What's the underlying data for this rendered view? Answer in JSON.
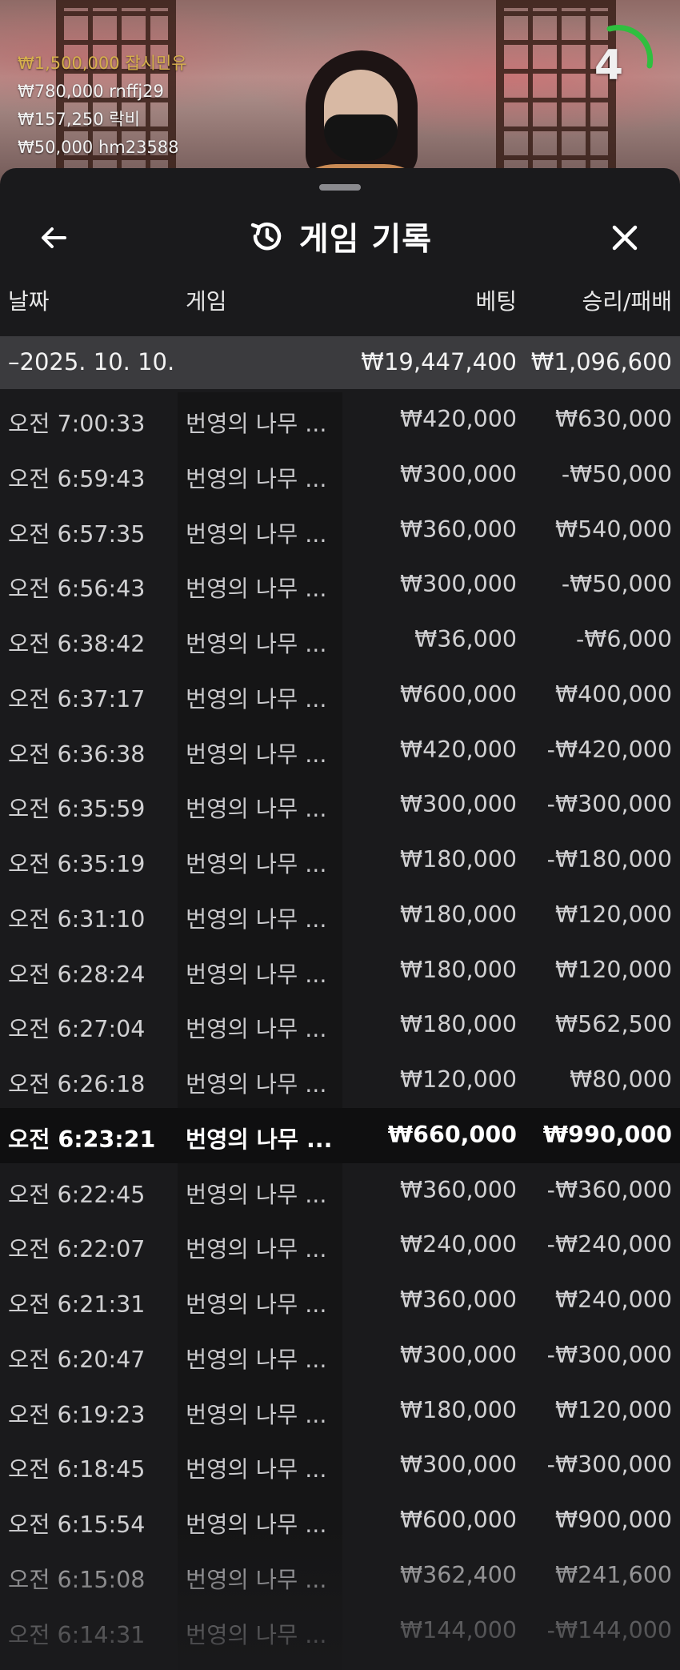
{
  "stream": {
    "winners": [
      {
        "amount": "₩1,500,000",
        "name": "잡시민유"
      },
      {
        "amount": "₩780,000",
        "name": "rnffj29"
      },
      {
        "amount": "₩157,250",
        "name": "락비"
      },
      {
        "amount": "₩50,000",
        "name": "hm23588"
      }
    ],
    "timer": "4",
    "timer_color": "#2fbf3f"
  },
  "sheet": {
    "title": "게임 기록",
    "title_icon": "history-icon",
    "back_icon": "back-arrow-icon",
    "close_icon": "close-icon"
  },
  "table": {
    "headers": {
      "date": "날짜",
      "game": "게임",
      "bet": "베팅",
      "result": "승리/패배"
    },
    "summary": {
      "date": "–2025. 10. 10.",
      "bet": "₩19,447,400",
      "result": "₩1,096,600"
    },
    "rows": [
      {
        "time": "오전 7:00:33",
        "game": "번영의 나무 ...",
        "bet": "₩420,000",
        "result": "₩630,000"
      },
      {
        "time": "오전 6:59:43",
        "game": "번영의 나무 ...",
        "bet": "₩300,000",
        "result": "-₩50,000"
      },
      {
        "time": "오전 6:57:35",
        "game": "번영의 나무 ...",
        "bet": "₩360,000",
        "result": "₩540,000"
      },
      {
        "time": "오전 6:56:43",
        "game": "번영의 나무 ...",
        "bet": "₩300,000",
        "result": "-₩50,000"
      },
      {
        "time": "오전 6:38:42",
        "game": "번영의 나무 ...",
        "bet": "₩36,000",
        "result": "-₩6,000"
      },
      {
        "time": "오전 6:37:17",
        "game": "번영의 나무 ...",
        "bet": "₩600,000",
        "result": "₩400,000"
      },
      {
        "time": "오전 6:36:38",
        "game": "번영의 나무 ...",
        "bet": "₩420,000",
        "result": "-₩420,000"
      },
      {
        "time": "오전 6:35:59",
        "game": "번영의 나무 ...",
        "bet": "₩300,000",
        "result": "-₩300,000"
      },
      {
        "time": "오전 6:35:19",
        "game": "번영의 나무 ...",
        "bet": "₩180,000",
        "result": "-₩180,000"
      },
      {
        "time": "오전 6:31:10",
        "game": "번영의 나무 ...",
        "bet": "₩180,000",
        "result": "₩120,000"
      },
      {
        "time": "오전 6:28:24",
        "game": "번영의 나무 ...",
        "bet": "₩180,000",
        "result": "₩120,000"
      },
      {
        "time": "오전 6:27:04",
        "game": "번영의 나무 ...",
        "bet": "₩180,000",
        "result": "₩562,500"
      },
      {
        "time": "오전 6:26:18",
        "game": "번영의 나무 ...",
        "bet": "₩120,000",
        "result": "₩80,000"
      },
      {
        "time": "오전 6:23:21",
        "game": "번영의 나무 ...",
        "bet": "₩660,000",
        "result": "₩990,000"
      },
      {
        "time": "오전 6:22:45",
        "game": "번영의 나무 ...",
        "bet": "₩360,000",
        "result": "-₩360,000"
      },
      {
        "time": "오전 6:22:07",
        "game": "번영의 나무 ...",
        "bet": "₩240,000",
        "result": "-₩240,000"
      },
      {
        "time": "오전 6:21:31",
        "game": "번영의 나무 ...",
        "bet": "₩360,000",
        "result": "₩240,000"
      },
      {
        "time": "오전 6:20:47",
        "game": "번영의 나무 ...",
        "bet": "₩300,000",
        "result": "-₩300,000"
      },
      {
        "time": "오전 6:19:23",
        "game": "번영의 나무 ...",
        "bet": "₩180,000",
        "result": "₩120,000"
      },
      {
        "time": "오전 6:18:45",
        "game": "번영의 나무 ...",
        "bet": "₩300,000",
        "result": "-₩300,000"
      },
      {
        "time": "오전 6:15:54",
        "game": "번영의 나무 ...",
        "bet": "₩600,000",
        "result": "₩900,000"
      },
      {
        "time": "오전 6:15:08",
        "game": "번영의 나무 ...",
        "bet": "₩362,400",
        "result": "₩241,600"
      },
      {
        "time": "오전 6:14:31",
        "game": "번영의 나무 ...",
        "bet": "₩144,000",
        "result": "-₩144,000"
      }
    ]
  }
}
